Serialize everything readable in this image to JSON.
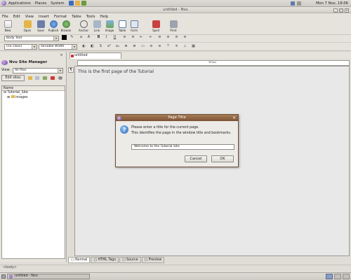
{
  "top_panel": {
    "menus": [
      "Applications",
      "Places",
      "System"
    ],
    "clock": "Mon 7 Nov, 18:06"
  },
  "window": {
    "title": "untitled - Nvu"
  },
  "menubar": [
    "File",
    "Edit",
    "View",
    "Insert",
    "Format",
    "Table",
    "Tools",
    "Help"
  ],
  "toolbar": [
    "New",
    "Open",
    "Save",
    "Publish",
    "Browse",
    "Anchor",
    "Link",
    "Image",
    "Table",
    "Form",
    "Spell",
    "Print"
  ],
  "format": {
    "paragraph_style": "Body Text",
    "class": "(no class)",
    "font": "Variable Width"
  },
  "sidebar": {
    "title": "Nvu Site Manager",
    "view_label": "View:",
    "view_value": "All files",
    "edit_sites": "Edit sites",
    "column_name": "Name",
    "tree": [
      "Tutorial_Site",
      "images"
    ]
  },
  "editor": {
    "tab": "untitled",
    "ruler_label": "383px",
    "content": "This is the first page of the Tutorial",
    "bottom_tabs": [
      "Normal",
      "HTML Tags",
      "Source",
      "Preview"
    ]
  },
  "status": {
    "text": "<body>"
  },
  "taskbar": {
    "item": "untitled - Nvu"
  },
  "dialog": {
    "title": "Page Title",
    "line1": "Please enter a title for the current page.",
    "line2": "This identifies the page in the window title and bookmarks.",
    "input_value": "Welcome to the Tutorial Site",
    "cancel": "Cancel",
    "ok": "OK"
  },
  "colors": {
    "dialog_title": "#8a6040",
    "editor_bg": "#e8e8e8",
    "panel_bg": "#e0ddd7"
  }
}
